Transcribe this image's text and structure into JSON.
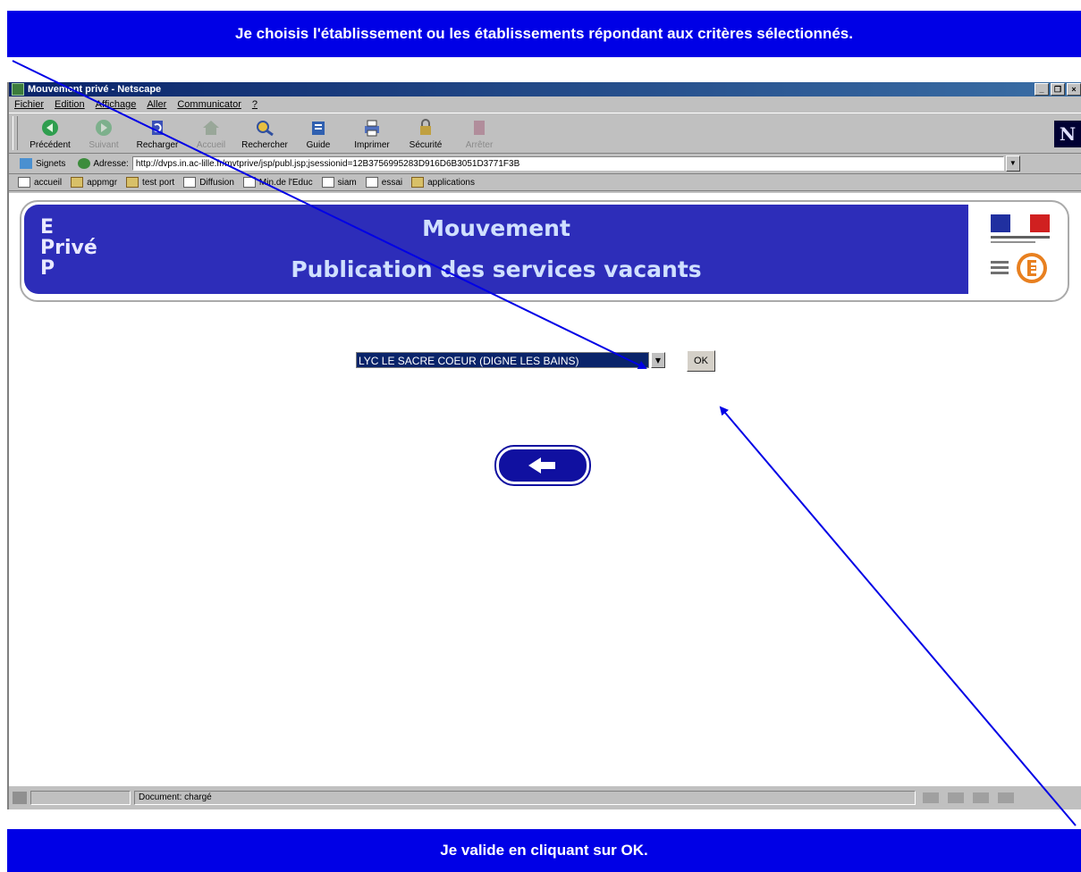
{
  "annotations": {
    "top_banner": "Je choisis l'établissement ou les établissements répondant aux critères sélectionnés.",
    "bottom_banner": "Je valide en cliquant sur OK.",
    "banner_color": "#0000e6",
    "arrow_color": "#0000e6"
  },
  "window": {
    "title": "Mouvement privé - Netscape",
    "controls": [
      "_",
      "❐",
      "×"
    ]
  },
  "menubar": {
    "items": [
      "Fichier",
      "Edition",
      "Affichage",
      "Aller",
      "Communicator",
      "?"
    ]
  },
  "toolbar": {
    "buttons": [
      {
        "label": "Précédent",
        "icon": "back-arrow-icon",
        "enabled": true
      },
      {
        "label": "Suivant",
        "icon": "forward-arrow-icon",
        "enabled": false
      },
      {
        "label": "Recharger",
        "icon": "reload-icon",
        "enabled": true
      },
      {
        "label": "Accueil",
        "icon": "home-icon",
        "enabled": false
      },
      {
        "label": "Rechercher",
        "icon": "search-icon",
        "enabled": true
      },
      {
        "label": "Guide",
        "icon": "guide-icon",
        "enabled": true
      },
      {
        "label": "Imprimer",
        "icon": "print-icon",
        "enabled": true
      },
      {
        "label": "Sécurité",
        "icon": "lock-icon",
        "enabled": true
      },
      {
        "label": "Arrêter",
        "icon": "stop-icon",
        "enabled": false
      }
    ],
    "logo": "N"
  },
  "locationbar": {
    "bookmarks_label": "Signets",
    "address_label": "Adresse:",
    "address_value": "http://dvps.in.ac-lille.fr/mvtprive/jsp/publ.jsp;jsessionid=12B3756995283D916D6B3051D3771F3B"
  },
  "personalbar": {
    "items": [
      "accueil",
      "appmgr",
      "test port",
      "Diffusion",
      "Min.de l'Educ",
      "siam",
      "essai",
      "applications"
    ]
  },
  "page": {
    "logo_lines": [
      "E",
      "Privé",
      "P"
    ],
    "title_line1": "Mouvement",
    "title_line2": "Publication des services vacants",
    "header_color": "#2d2db9",
    "select_value": "LYC LE SACRE COEUR (DIGNE LES BAINS)",
    "ok_label": "OK",
    "back_icon": "back-arrow-icon"
  },
  "statusbar": {
    "text": "Document: chargé"
  }
}
